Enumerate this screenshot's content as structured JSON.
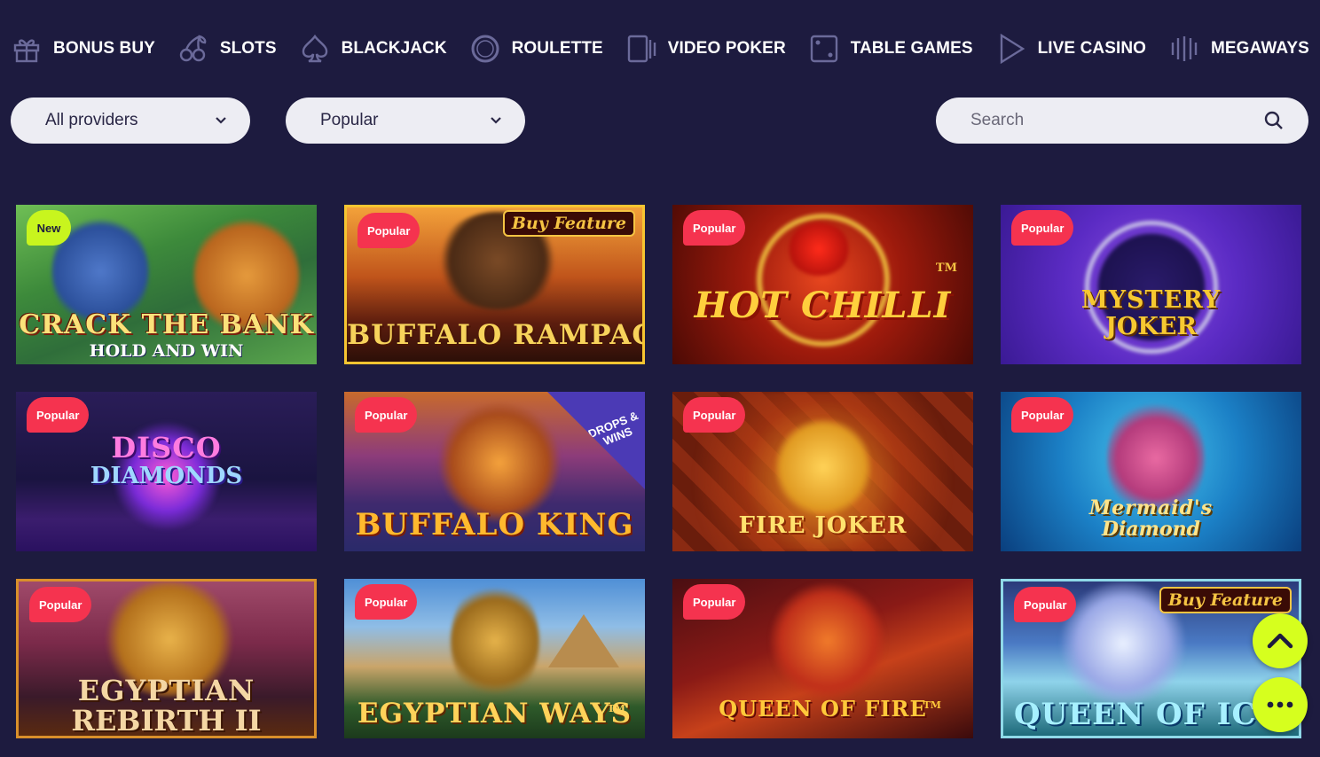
{
  "nav": {
    "items": [
      {
        "label": "BONUS BUY",
        "icon": "gift-icon"
      },
      {
        "label": "SLOTS",
        "icon": "cherries-icon"
      },
      {
        "label": "BLACKJACK",
        "icon": "spade-icon"
      },
      {
        "label": "ROULETTE",
        "icon": "roulette-wheel-icon"
      },
      {
        "label": "VIDEO POKER",
        "icon": "video-poker-cards-icon"
      },
      {
        "label": "TABLE GAMES",
        "icon": "dice-icon"
      },
      {
        "label": "LIVE CASINO",
        "icon": "play-icon"
      },
      {
        "label": "MEGAWAYS",
        "icon": "megaways-bars-icon"
      }
    ]
  },
  "filters": {
    "providers": {
      "value": "All providers",
      "icon": "chevron-down-icon"
    },
    "sort": {
      "value": "Popular",
      "icon": "chevron-down-icon"
    },
    "search": {
      "placeholder": "Search",
      "icon": "search-icon"
    }
  },
  "colors": {
    "background": "#1d1b3f",
    "badge_popular": "#f5334f",
    "badge_new": "#c8f51e",
    "fab": "#d6ff1e"
  },
  "games": [
    {
      "title": "CRACK THE BANK",
      "subtitle": "HOLD AND WIN",
      "badge": "New"
    },
    {
      "title": "BUFFALO RAMPAGE",
      "subtitle": "",
      "badge": "Popular",
      "tag": "Buy Feature"
    },
    {
      "title": "HOT CHILLI",
      "subtitle": "",
      "badge": "Popular",
      "tag": "TM"
    },
    {
      "title": "MYSTERY",
      "subtitle": "JOKER",
      "badge": "Popular"
    },
    {
      "title": "DISCO",
      "subtitle": "DIAMONDS",
      "badge": "Popular"
    },
    {
      "title": "BUFFALO KING",
      "subtitle": "",
      "badge": "Popular",
      "tag": "DROPS & WINS"
    },
    {
      "title": "FIRE JOKER",
      "subtitle": "",
      "badge": "Popular"
    },
    {
      "title": "Mermaid's",
      "subtitle": "Diamond",
      "badge": "Popular"
    },
    {
      "title": "EGYPTIAN",
      "subtitle": "REBIRTH II",
      "badge": "Popular"
    },
    {
      "title": "EGYPTIAN WAYS",
      "subtitle": "",
      "badge": "Popular",
      "tag": "TM"
    },
    {
      "title": "QUEEN OF FIRE",
      "subtitle": "",
      "badge": "Popular",
      "tag": "TM"
    },
    {
      "title": "QUEEN OF IC",
      "subtitle": "",
      "badge": "Popular",
      "tag": "Buy Feature"
    }
  ],
  "floating": {
    "scroll_top": {
      "icon": "chevron-up-icon"
    },
    "chat": {
      "icon": "chat-dots-icon"
    }
  }
}
